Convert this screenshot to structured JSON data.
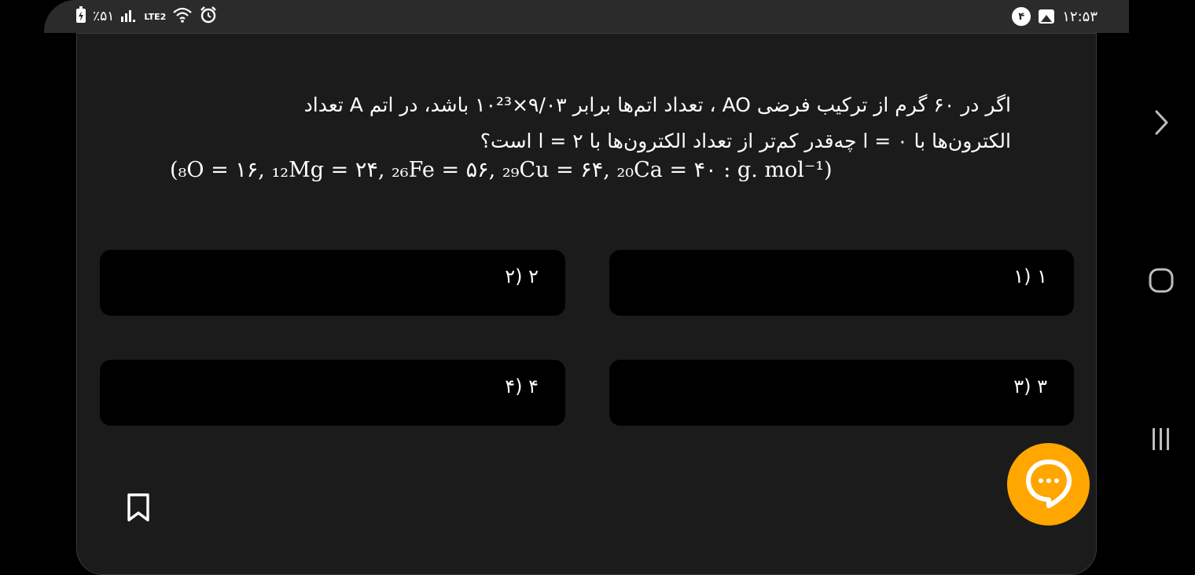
{
  "status_bar": {
    "battery": "٪۵۱",
    "network": "LTE2",
    "notification_count": "۴",
    "time": "۱۲:۵۳"
  },
  "question": {
    "line1": "اگر در ۶۰ گرم از ترکیب فرضی AO ، تعداد اتم‌ها برابر ۹/۰۳×۱۰²³ باشد، در اتم A تعداد",
    "line2": "الکترون‌ها با l = ۰ چه‌قدر کم‌تر از تعداد الکترون‌ها با l = ۲ است؟",
    "formula": "(₈O = ۱۶, ₁₂Mg = ۲۴, ₂₆Fe = ۵۶, ₂₉Cu = ۶۴, ₂₀Ca = ۴۰ : g. mol⁻¹)"
  },
  "options": [
    {
      "label": "۱ (۱"
    },
    {
      "label": "۲ (۲"
    },
    {
      "label": "۳ (۳"
    },
    {
      "label": "۴ (۴"
    }
  ],
  "icons": {
    "bookmark": "bookmark-icon",
    "chat": "chat-bubble-icon",
    "back": "chevron-right-icon",
    "home": "home-icon",
    "recents": "recents-icon"
  },
  "colors": {
    "card": "#1b1b1b",
    "option_bg": "#000000",
    "fab": "#ffa600",
    "status_bar": "#2b2b2b"
  }
}
